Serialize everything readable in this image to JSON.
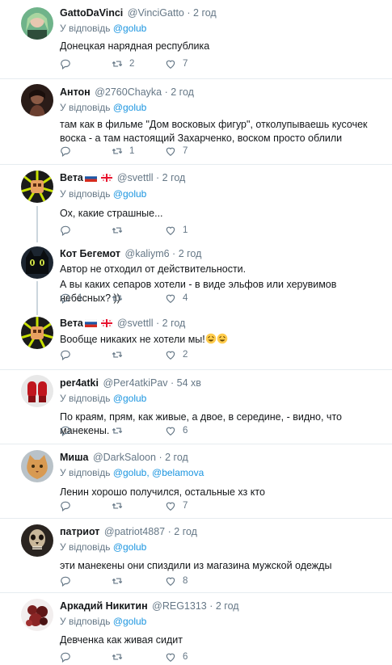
{
  "reply_prefix": "У відповідь",
  "separator": "·",
  "tweets": [
    {
      "name": "GattoDaVinci",
      "handle": "@VinciGatto",
      "time": "2 год",
      "mentions": [
        "@golub"
      ],
      "text": "Донецкая нарядная республика",
      "replies": "",
      "retweets": "2",
      "likes": "7"
    },
    {
      "name": "Антон",
      "handle": "@2760Chayka",
      "time": "2 год",
      "mentions": [
        "@golub"
      ],
      "text": "там как в фильме \"Дом восковых фигур\", отколупываешь кусочек воска - а там настоящий Захарченко, воском просто облили",
      "replies": "",
      "retweets": "1",
      "likes": "7"
    },
    {
      "name": "Вета",
      "handle": "@svettll",
      "time": "2 год",
      "mentions": [
        "@golub"
      ],
      "text": "Ох, какие страшные...",
      "replies": "",
      "retweets": "",
      "likes": "1",
      "flags": [
        "russia-flag-icon",
        "georgia-flag-icon"
      ]
    },
    {
      "name": "Кот Бегемот",
      "handle": "@kaliym6",
      "time": "2 год",
      "mentions": [],
      "text": "Автор не отходил от  действительности.",
      "text2": "А вы каких сепаров хотели - в виде эльфов или херувимов небесных? ))",
      "replies": "1",
      "retweets": "",
      "likes": "4"
    },
    {
      "name": "Вета",
      "handle": "@svettll",
      "time": "2 год",
      "mentions": [],
      "text": "Вообще никаких не хотели мы!",
      "replies": "",
      "retweets": "",
      "likes": "2",
      "flags": [
        "russia-flag-icon",
        "georgia-flag-icon"
      ],
      "emoji": [
        "rofl-emoji",
        "rofl-emoji"
      ]
    },
    {
      "name": "per4atki",
      "handle": "@Per4atkiPav",
      "time": "54 хв",
      "mentions": [
        "@golub"
      ],
      "text": "По краям, прям, как живые, а двое, в середине, - видно, что манекены.",
      "replies": "",
      "retweets": "",
      "likes": "6"
    },
    {
      "name": "Миша",
      "handle": "@DarkSaloon",
      "time": "2 год",
      "mentions": [
        "@golub",
        "@belamova"
      ],
      "text": "Ленин хорошо получился, остальные хз кто",
      "replies": "",
      "retweets": "",
      "likes": "7"
    },
    {
      "name": "патриот",
      "handle": "@patriot4887",
      "time": "2 год",
      "mentions": [
        "@golub"
      ],
      "text": "эти манекены они спиздили из магазина мужской одежды",
      "replies": "",
      "retweets": "",
      "likes": "8"
    },
    {
      "name": "Аркадий Никитин",
      "handle": "@REG1313",
      "time": "2 год",
      "mentions": [
        "@golub"
      ],
      "text": "Девченка как живая сидит",
      "replies": "",
      "retweets": "",
      "likes": "6"
    }
  ],
  "colors": {
    "link": "#1b95e0",
    "muted": "#657786",
    "text": "#14171a",
    "divider": "#e6ecf0"
  }
}
